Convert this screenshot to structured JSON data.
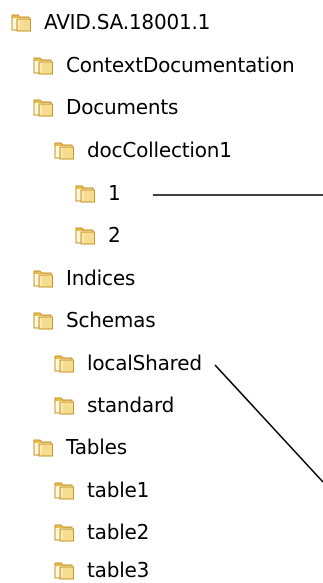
{
  "tree": {
    "items": [
      {
        "label": "AVID.SA.18001.1",
        "depth": 0
      },
      {
        "label": "ContextDocumentation",
        "depth": 1
      },
      {
        "label": "Documents",
        "depth": 1
      },
      {
        "label": "docCollection1",
        "depth": 2
      },
      {
        "label": "1",
        "depth": 3
      },
      {
        "label": "2",
        "depth": 3
      },
      {
        "label": "Indices",
        "depth": 1
      },
      {
        "label": "Schemas",
        "depth": 1
      },
      {
        "label": "localShared",
        "depth": 2
      },
      {
        "label": "standard",
        "depth": 2
      },
      {
        "label": "Tables",
        "depth": 1
      },
      {
        "label": "table1",
        "depth": 2
      },
      {
        "label": "table2",
        "depth": 2
      },
      {
        "label": "table3",
        "depth": 2
      }
    ]
  },
  "icons": {
    "folder": "folder-icon"
  },
  "colors": {
    "folder_light": "#f6dc8e",
    "folder_mid": "#e8bd4e",
    "folder_dark": "#c9962c",
    "connector": "#000000"
  }
}
